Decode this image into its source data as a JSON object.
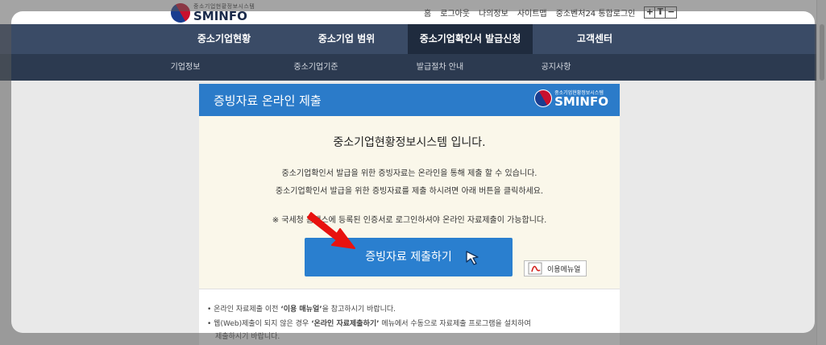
{
  "header": {
    "logo_small": "중소기업현황정보시스템",
    "logo_big": "SMINFO",
    "util_links": [
      "홈",
      "로그아웃",
      "나의정보",
      "사이트맵",
      "중소벤처24 통합로그인"
    ],
    "font_buttons": [
      "+",
      "T",
      "−"
    ]
  },
  "nav": {
    "main": [
      "중소기업현황",
      "중소기업 범위",
      "중소기업확인서 발급신청",
      "고객센터"
    ],
    "active_index": 2,
    "sub": [
      "기업정보",
      "중소기업기준",
      "발급절차 안내",
      "공지사항"
    ]
  },
  "popup": {
    "title": "증빙자료 온라인 제출",
    "logo_small": "중소기업현황정보시스템",
    "logo_big": "SMINFO",
    "heading": "중소기업현황정보시스템 입니다.",
    "desc1": "중소기업확인서 발급을 위한 증빙자료는 온라인을 통해 제출 할 수 있습니다.",
    "desc2": "중소기업확인서 발급을 위한 증빙자료를 제출 하시려면 아래 버튼을 클릭하세요.",
    "notice": "※ 국세청 홈택스에 등록된 인증서로 로그인하셔야 온라인 자료제출이 가능합니다.",
    "submit_label": "증빙자료 제출하기",
    "manual_label": "이용메뉴얼",
    "foot1_pre": "온라인 자료제출 이전 ",
    "foot1_bold": "‘이용 매뉴얼’",
    "foot1_post": "을 참고하시기 바랍니다.",
    "foot2_pre": "웹(Web)제출이 되지 않은 경우 ",
    "foot2_bold": "‘온라인 자료제출하기’",
    "foot2_post": " 메뉴에서 수동으로 자료제출 프로그램을 설치하여",
    "foot3": "제출하시기 바랍니다."
  },
  "colors": {
    "nav_main": "#3a4b66",
    "nav_active": "#1f2b3e",
    "nav_sub": "#2c3a50",
    "popup_header": "#2b7bc9",
    "popup_body": "#faf7ea",
    "submit_button": "#2a7fcf",
    "arrow": "#e8120f"
  }
}
